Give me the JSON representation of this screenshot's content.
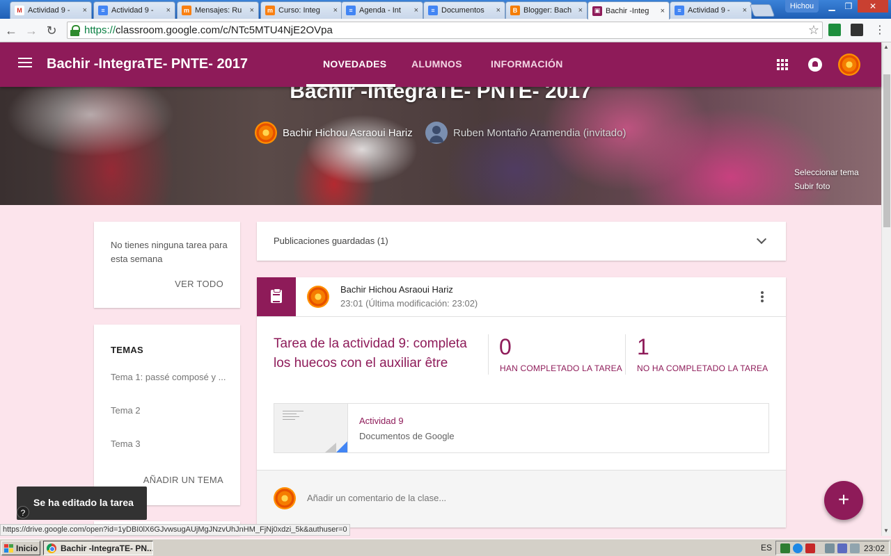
{
  "browser": {
    "tabs": [
      {
        "label": "Actividad 9 -",
        "icon": "gmail-icon",
        "color": "#d93025",
        "active": false
      },
      {
        "label": "Actividad 9 -",
        "icon": "docs-icon",
        "color": "#4285f4",
        "active": false
      },
      {
        "label": "Mensajes: Ru",
        "icon": "moodle-icon",
        "color": "#f98012",
        "active": false
      },
      {
        "label": "Curso: Integ",
        "icon": "moodle-icon",
        "color": "#f98012",
        "active": false
      },
      {
        "label": "Agenda - Int",
        "icon": "docs-icon",
        "color": "#4285f4",
        "active": false
      },
      {
        "label": "Documentos",
        "icon": "docs-icon",
        "color": "#4285f4",
        "active": false
      },
      {
        "label": "Blogger: Bach",
        "icon": "blogger-icon",
        "color": "#f57d00",
        "active": false
      },
      {
        "label": "Bachir -Integ",
        "icon": "classroom-icon",
        "color": "#8e1b59",
        "active": true
      },
      {
        "label": "Actividad 9 -",
        "icon": "docs-icon",
        "color": "#4285f4",
        "active": false
      }
    ],
    "tab_close_glyph": "×",
    "user_name": "Hichou",
    "url_scheme": "https://",
    "url_rest": "classroom.google.com/c/NTc5MTU4NjE2OVpa",
    "status_url": "https://drive.google.com/open?id=1yDBI0lX6GJvwsugAUjMgJNzvUhJnHM_FjNj0xdzi_5k&authuser=0"
  },
  "header": {
    "course_title": "Bachir -IntegraTE- PNTE- 2017",
    "tabs": [
      {
        "label": "NOVEDADES",
        "active": true
      },
      {
        "label": "ALUMNOS",
        "active": false
      },
      {
        "label": "INFORMACIÓN",
        "active": false
      }
    ],
    "accent": "#8e1b59"
  },
  "banner": {
    "title": "Bachir -IntegraTE- PNTE- 2017",
    "teacher": "Bachir Hichou Asraoui Hariz",
    "guest": "Ruben Montaño Aramendia (invitado)",
    "select_theme": "Seleccionar tema",
    "upload_photo": "Subir foto"
  },
  "upcoming": {
    "message": "No tienes ninguna tarea para esta semana",
    "view_all": "VER TODO"
  },
  "topics": {
    "heading": "TEMAS",
    "items": [
      "Tema 1: passé composé y ...",
      "Tema 2",
      "Tema 3"
    ],
    "add_label": "AÑADIR UN TEMA"
  },
  "saved_posts": {
    "label": "Publicaciones guardadas (1)"
  },
  "post": {
    "author": "Bachir Hichou Asraoui Hariz",
    "time": "23:01 (Última modificación: 23:02)",
    "title": "Tarea de la actividad 9: completa los huecos con el auxiliar être",
    "completed_count": "0",
    "completed_label": "HAN COMPLETADO LA TAREA",
    "not_completed_count": "1",
    "not_completed_label": "NO HA COMPLETADO LA TAREA",
    "attachment_title": "Actividad 9",
    "attachment_type": "Documentos de Google",
    "comment_placeholder": "Añadir un comentario de la clase..."
  },
  "fab_label": "+",
  "toast": {
    "message": "Se ha editado la tarea",
    "help": "?"
  },
  "taskbar": {
    "start_label": "Inicio",
    "window_label": "Bachir -IntegraTE- PN...",
    "language": "ES",
    "clock": "23:02"
  }
}
